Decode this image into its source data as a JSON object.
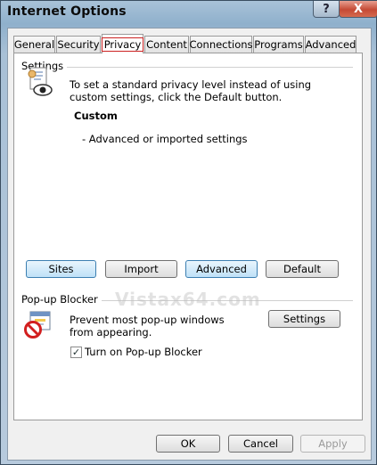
{
  "window": {
    "title": "Internet Options",
    "help_glyph": "?",
    "close_glyph": "X"
  },
  "tabs": [
    "General",
    "Security",
    "Privacy",
    "Content",
    "Connections",
    "Programs",
    "Advanced"
  ],
  "active_tab": "Privacy",
  "settings": {
    "label": "Settings",
    "description": "To set a standard privacy level instead of using custom settings, click the Default button.",
    "level_title": "Custom",
    "level_detail": "- Advanced or imported settings",
    "buttons": {
      "sites": "Sites",
      "import": "Import",
      "advanced": "Advanced",
      "default": "Default"
    }
  },
  "popup_blocker": {
    "label": "Pop-up Blocker",
    "watermark": "Vistax64.com",
    "description": "Prevent most pop-up windows from appearing.",
    "settings_button": "Settings",
    "checkbox_label": "Turn on Pop-up Blocker",
    "checked": true,
    "check_glyph": "✓"
  },
  "footer": {
    "ok": "OK",
    "cancel": "Cancel",
    "apply": "Apply"
  },
  "icons": {
    "privacy": "privacy-eye-document-icon",
    "popup": "popup-blocker-icon"
  }
}
